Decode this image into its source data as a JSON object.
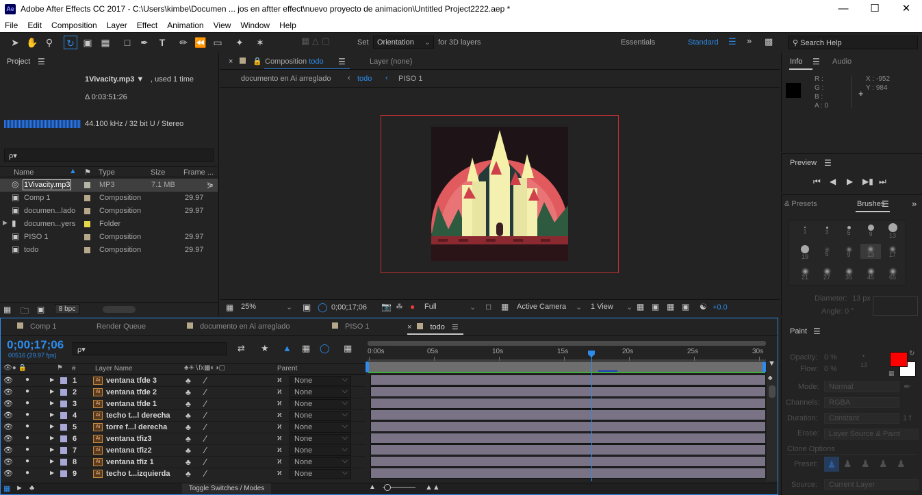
{
  "app": {
    "logo": "Ae",
    "title": "Adobe After Effects CC 2017 - C:\\Users\\kimbe\\Documen ... jos en aftter effect\\nuevo proyecto de animacion\\Untitled Project2222.aep *"
  },
  "menu": [
    "File",
    "Edit",
    "Composition",
    "Layer",
    "Effect",
    "Animation",
    "View",
    "Window",
    "Help"
  ],
  "toolbar": {
    "set_label": "Set",
    "orientation": "Orientation",
    "for3d": "for 3D layers",
    "essentials": "Essentials",
    "standard": "Standard",
    "search_placeholder": "Search Help"
  },
  "project": {
    "title": "Project",
    "file_name": "1Vivacity.mp3 ▼",
    "used": ", used 1 time",
    "duration": "Δ 0:03:51:26",
    "audio_info": "44.100 kHz / 32 bit U / Stereo",
    "search_placeholder": "ρ▾",
    "columns": {
      "name": "Name",
      "type": "Type",
      "size": "Size",
      "frame": "Frame ..."
    },
    "items": [
      {
        "name": "1Vivacity.mp3",
        "type": "MP3",
        "size": "7.1 MB",
        "frame": "",
        "color": "#b5b5a8",
        "icon": "audio-icon"
      },
      {
        "name": "Comp 1",
        "type": "Composition",
        "size": "",
        "frame": "29.97",
        "color": "#b5a78a",
        "icon": "composition-icon"
      },
      {
        "name": "documen...lado",
        "type": "Composition",
        "size": "",
        "frame": "29.97",
        "color": "#b5a78a",
        "icon": "composition-icon"
      },
      {
        "name": "documen...yers",
        "type": "Folder",
        "size": "",
        "frame": "",
        "color": "#e5d84a",
        "icon": "folder-icon"
      },
      {
        "name": "PISO 1",
        "type": "Composition",
        "size": "",
        "frame": "29.97",
        "color": "#b5a78a",
        "icon": "composition-icon"
      },
      {
        "name": "todo",
        "type": "Composition",
        "size": "",
        "frame": "29.97",
        "color": "#b5a78a",
        "icon": "composition-icon"
      }
    ],
    "bpc": "8 bpc"
  },
  "composition": {
    "tab_prefix": "Composition",
    "tab_name": "todo",
    "layer_tab": "Layer (none)",
    "breadcrumbs": [
      "documento en Ai arreglado",
      "todo",
      "PISO 1"
    ],
    "zoom": "25%",
    "timecode": "0;00;17;06",
    "resolution": "Full",
    "camera": "Active Camera",
    "views": "1 View",
    "exposure": "+0.0"
  },
  "info": {
    "tab_info": "Info",
    "tab_audio": "Audio",
    "r": "R :",
    "g": "G :",
    "b": "B :",
    "a": "A : 0",
    "x": "X : -952",
    "y": "Y : 984"
  },
  "preview": {
    "title": "Preview"
  },
  "brushes": {
    "tab_presets": "& Presets",
    "tab_brushes": "Brushes",
    "sizes": [
      "1",
      "3",
      "5",
      "9",
      "13",
      "19",
      "5",
      "9",
      "13",
      "17",
      "21",
      "27",
      "35",
      "45",
      "65"
    ],
    "diameter_label": "Diameter:",
    "diameter_value": "13 px",
    "angle_label": "Angle:",
    "angle_value": "0 °"
  },
  "timeline": {
    "tabs": [
      "Comp 1",
      "Render Queue",
      "documento en Ai arreglado",
      "PISO 1",
      "todo"
    ],
    "timecode": "0;00;17;06",
    "frame_info": "00516 (29.97 fps)",
    "search_placeholder": "ρ▾",
    "col_layer_name": "Layer Name",
    "col_parent": "Parent",
    "col_num": "#",
    "ruler": [
      "0:00s",
      "05s",
      "10s",
      "15s",
      "20s",
      "25s",
      "30s"
    ],
    "playhead_fraction": 0.573,
    "layers": [
      {
        "num": "1",
        "name": "ventana tfde 3",
        "parent": "None"
      },
      {
        "num": "2",
        "name": "ventana tfde 2",
        "parent": "None"
      },
      {
        "num": "3",
        "name": "ventana tfde 1",
        "parent": "None"
      },
      {
        "num": "4",
        "name": "techo t...l derecha",
        "parent": "None"
      },
      {
        "num": "5",
        "name": "torre f...l derecha",
        "parent": "None"
      },
      {
        "num": "6",
        "name": "ventana tfiz3",
        "parent": "None"
      },
      {
        "num": "7",
        "name": "ventana tfiz2",
        "parent": "None"
      },
      {
        "num": "8",
        "name": "ventana tfiz 1",
        "parent": "None"
      },
      {
        "num": "9",
        "name": "techo t...izquierda",
        "parent": "None"
      }
    ],
    "toggle_label": "Toggle Switches / Modes"
  },
  "paint": {
    "title": "Paint",
    "opacity_label": "Opacity:",
    "opacity_value": "0 %",
    "flow_label": "Flow:",
    "flow_value": "0 %",
    "brush_size": "13",
    "mode_label": "Mode:",
    "mode_value": "Normal",
    "channels_label": "Channels:",
    "channels_value": "RGBA",
    "duration_label": "Duration:",
    "duration_value": "Constant",
    "duration_frames": "1 f",
    "erase_label": "Erase:",
    "erase_value": "Layer Source & Paint",
    "clone_options": "Clone Options",
    "preset_label": "Preset:",
    "source_label": "Source:",
    "source_value": "Current Layer",
    "fg_color": "#ff0000",
    "bg_color": "#ffffff"
  }
}
